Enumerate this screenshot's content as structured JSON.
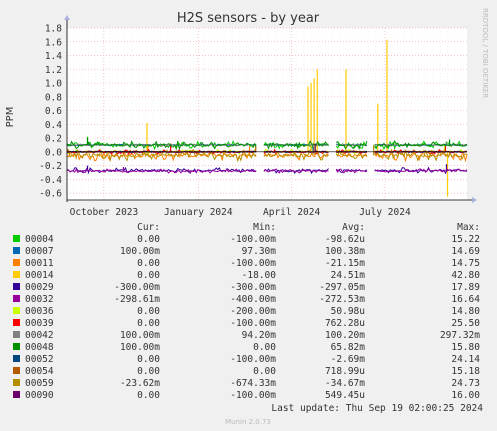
{
  "chart_data": {
    "type": "line",
    "title": "H2S sensors - by year",
    "ylabel": "PPM",
    "side_label": "RRDTOOL / TOBI OETIKER",
    "ylim": [
      -0.7,
      1.8
    ],
    "yticks": [
      -0.6,
      -0.4,
      -0.2,
      0.0,
      0.2,
      0.4,
      0.6,
      0.8,
      1.0,
      1.2,
      1.4,
      1.6,
      1.8
    ],
    "ytick_labels": [
      "-0.6",
      "-0.4",
      "-0.2",
      "0.0",
      "0.2",
      "0.4",
      "0.6",
      "0.8",
      "1.0",
      "1.2",
      "1.4",
      "1.6",
      "1.8"
    ],
    "xlim": [
      "2023-08-26",
      "2024-09-19"
    ],
    "xticks": [
      "2023-10-01",
      "2024-01-01",
      "2024-04-01",
      "2024-07-01"
    ],
    "xtick_labels": [
      "October 2023",
      "January 2024",
      "April 2024",
      "July 2024"
    ],
    "grid": true,
    "columns": [
      "Cur:",
      "Min:",
      "Avg:",
      "Max:"
    ],
    "series": [
      {
        "name": "00004",
        "color": "#00cc00",
        "base": 0.1,
        "spikes": [
          [
            "2023-09-15",
            0.22
          ],
          [
            "2024-08-30",
            0.15
          ]
        ],
        "stats": [
          "0.00",
          "-100.00m",
          "-98.62u",
          "15.22"
        ]
      },
      {
        "name": "00007",
        "color": "#0066b3",
        "base": 0.1,
        "spikes": [
          [
            "2023-09-16",
            0.14
          ]
        ],
        "stats": [
          "100.00m",
          "97.30m",
          "100.38m",
          "14.69"
        ]
      },
      {
        "name": "00011",
        "color": "#ff8000",
        "base": -0.05,
        "spikes": [
          [
            "2023-11-13",
            0.1
          ],
          [
            "2024-02-20",
            0.08
          ]
        ],
        "stats": [
          "0.00",
          "-100.00m",
          "-21.15m",
          "14.75"
        ]
      },
      {
        "name": "00014",
        "color": "#ffcc00",
        "base": 0.0,
        "spikes": [
          [
            "2023-11-12",
            0.42
          ],
          [
            "2024-04-17",
            0.95
          ],
          [
            "2024-04-20",
            1.0
          ],
          [
            "2024-04-23",
            1.07
          ],
          [
            "2024-04-26",
            1.2
          ],
          [
            "2024-05-24",
            1.2
          ],
          [
            "2024-06-24",
            0.7
          ],
          [
            "2024-07-03",
            1.63
          ],
          [
            "2024-08-31",
            -0.65
          ]
        ],
        "stats": [
          "0.00",
          "-18.00",
          "24.51m",
          "42.80"
        ]
      },
      {
        "name": "00029",
        "color": "#330099",
        "base": -0.27,
        "spikes": [
          [
            "2023-09-15",
            -0.2
          ],
          [
            "2024-08-30",
            -0.18
          ]
        ],
        "stats": [
          "-300.00m",
          "-300.00m",
          "-297.05m",
          "17.89"
        ]
      },
      {
        "name": "00032",
        "color": "#990099",
        "base": -0.28,
        "spikes": [
          [
            "2023-10-20",
            -0.22
          ]
        ],
        "stats": [
          "-298.61m",
          "-400.00m",
          "-272.53m",
          "16.64"
        ]
      },
      {
        "name": "00036",
        "color": "#ccff00",
        "base": 0.0,
        "spikes": [
          [
            "2024-08-28",
            0.08
          ]
        ],
        "stats": [
          "0.00",
          "-200.00m",
          "50.98u",
          "14.80"
        ]
      },
      {
        "name": "00039",
        "color": "#ff0000",
        "base": 0.0,
        "spikes": [
          [
            "2023-12-05",
            0.12
          ],
          [
            "2024-08-29",
            0.1
          ]
        ],
        "stats": [
          "0.00",
          "-100.00m",
          "762.28u",
          "25.50"
        ]
      },
      {
        "name": "00042",
        "color": "#808080",
        "base": 0.1,
        "spikes": [
          [
            "2024-08-30",
            0.14
          ]
        ],
        "stats": [
          "100.00m",
          "94.20m",
          "100.20m",
          "297.32m"
        ]
      },
      {
        "name": "00048",
        "color": "#008f00",
        "base": 0.1,
        "spikes": [
          [
            "2023-09-15",
            0.2
          ],
          [
            "2024-09-02",
            0.18
          ]
        ],
        "stats": [
          "100.00m",
          "0.00",
          "65.82m",
          "15.80"
        ]
      },
      {
        "name": "00052",
        "color": "#00487d",
        "base": 0.0,
        "spikes": [
          [
            "2024-04-22",
            0.08
          ]
        ],
        "stats": [
          "0.00",
          "-100.00m",
          "-2.69m",
          "24.14"
        ]
      },
      {
        "name": "00054",
        "color": "#b35a00",
        "base": 0.0,
        "spikes": [
          [
            "2024-02-26",
            0.08
          ]
        ],
        "stats": [
          "0.00",
          "0.00",
          "718.99u",
          "15.18"
        ]
      },
      {
        "name": "00059",
        "color": "#b38f00",
        "base": -0.05,
        "spikes": [
          [
            "2024-06-20",
            0.1
          ]
        ],
        "stats": [
          "-23.62m",
          "-674.33m",
          "-34.67m",
          "24.73"
        ]
      },
      {
        "name": "00090",
        "color": "#6b006b",
        "base": 0.0,
        "spikes": [
          [
            "2024-04-24",
            0.12
          ]
        ],
        "stats": [
          "0.00",
          "-100.00m",
          "549.45u",
          "16.00"
        ]
      }
    ],
    "gaps": [
      [
        "2024-02-27",
        "2024-03-04"
      ],
      [
        "2024-05-08",
        "2024-05-13"
      ],
      [
        "2024-06-14",
        "2024-06-20"
      ]
    ],
    "last_update": "Last update:  Thu Sep 19 02:00:25 2024",
    "footer": "Munin 2.0.73"
  }
}
